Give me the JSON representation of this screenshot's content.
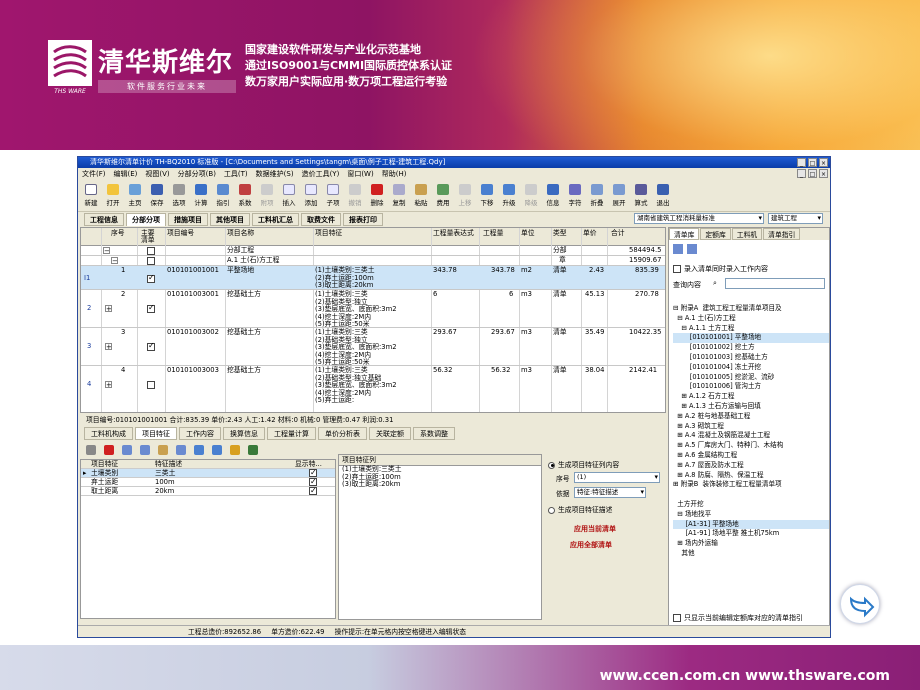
{
  "banner": {
    "brand": "清华斯维尔",
    "logo_sub": "THS WARE",
    "slogan": "软件服务行业未来",
    "taglines": [
      "国家建设软件研发与产业化示范基地",
      "通过ISO9001与CMMI国际质控体系认证",
      "数万家用户实际应用·数万项工程运行考验"
    ],
    "urls": "www.ccen.com.cn   www.thsware.com"
  },
  "window": {
    "title": "清华斯维尔清单计价 TH-BQ2010 标准版 - [C:\\Documents and Settings\\tangm\\桌面\\例子工程-建筑工程.Qdy]",
    "menus": [
      "文件(F)",
      "编辑(E)",
      "视图(V)",
      "分部分项(B)",
      "工具(T)",
      "数据维护(S)",
      "造价工具(Y)",
      "窗口(W)",
      "帮助(H)"
    ],
    "toolbar": [
      "新建",
      "打开",
      "主页",
      "保存",
      "选项",
      "计算",
      "指引",
      "系数",
      "附项",
      "插入",
      "添加",
      "子项",
      "撤销",
      "删除",
      "复制",
      "粘贴",
      "费用",
      "上移",
      "下移",
      "升级",
      "降级",
      "信息",
      "字符",
      "折叠",
      "展开",
      "算式",
      "退出"
    ],
    "tabs": [
      "工程信息",
      "分部分项",
      "措施项目",
      "其他项目",
      "工料机汇总",
      "取费文件",
      "报表打印"
    ],
    "region_select": "湖南省建筑工程消耗量标准",
    "type_select": "建筑工程"
  },
  "grid": {
    "headers": [
      "序号",
      "主要清单",
      "项目编号",
      "项目名称",
      "项目特征",
      "工程量表达式",
      "工程量",
      "单位",
      "类型",
      "单价",
      "合计"
    ],
    "rows": [
      {
        "name": "分部工程",
        "type": "分部",
        "total": "584494.5"
      },
      {
        "name": "A.1 土(石)方工程",
        "type": "章",
        "total": "15909.67"
      },
      {
        "idx": "I1",
        "seq": "1",
        "code": "010101001001",
        "name": "平整场地",
        "feat": "(1)土壤类别:三类土\n(2)弃土运距:100m\n(3)取土距离:20km",
        "expr": "343.78",
        "qty": "343.78",
        "unit": "m2",
        "type": "清单",
        "price": "2.43",
        "total": "835.39"
      },
      {
        "idx": "2",
        "seq": "2",
        "code": "010101003001",
        "name": "挖基础土方",
        "feat": "(1)土壤类别:三类\n(2)基础类型:独立\n(3)垫层底宽、底面积:3m2\n(4)挖土深度:2M内\n(5)弃土运距:50米",
        "expr": "6",
        "qty": "6",
        "unit": "m3",
        "type": "清单",
        "price": "45.13",
        "total": "270.78"
      },
      {
        "idx": "3",
        "seq": "3",
        "code": "010101003002",
        "name": "挖基础土方",
        "feat": "(1)土壤类别:三类\n(2)基础类型:独立\n(3)垫层底宽、底面积:3m2\n(4)挖土深度:2M内\n(5)弃土运距:50米",
        "expr": "293.67",
        "qty": "293.67",
        "unit": "m3",
        "type": "清单",
        "price": "35.49",
        "total": "10422.35"
      },
      {
        "idx": "4",
        "seq": "4",
        "code": "010101003003",
        "name": "挖基础土方",
        "feat": "(1)土壤类别:三类\n(2)基础类型:独立基础\n(3)垫层底宽、底面积:3m2\n(4)挖土深度:2M内\n(5)弃土运距:",
        "expr": "56.32",
        "qty": "56.32",
        "unit": "m3",
        "type": "清单",
        "price": "38.04",
        "total": "2142.41"
      }
    ]
  },
  "infoline": "项目编号:010101001001  合计:835.39  单价:2.43  人工:1.42  材料:0  机械:0  管理费:0.47  利润:0.31",
  "subtabs": [
    "工料机构成",
    "项目特征",
    "工作内容",
    "换算信息",
    "工程量计算",
    "单价分析表",
    "关联定额",
    "系数调整"
  ],
  "features": {
    "headers": [
      "项目特征",
      "特征描述",
      "显示特..."
    ],
    "rows": [
      [
        "土壤类别",
        "三类土"
      ],
      [
        "弃土运距",
        "100m"
      ],
      [
        "取土距离",
        "20km"
      ]
    ]
  },
  "feature_text": {
    "header": "项目特征列",
    "lines": [
      "(1)土壤类别:三类土",
      "(2)弃土运距:100m",
      "(3)取土距离:20km"
    ]
  },
  "options": {
    "radio1": "生成项目特征列内容",
    "seq_label": "序号",
    "seq_value": "(1)",
    "basis_label": "依据",
    "basis_value": "特征:特征描述",
    "radio2": "生成项目特征描述",
    "apply_current": "应用当前清单",
    "apply_all": "应用全部清单"
  },
  "rpanel": {
    "tabs": [
      "清单库",
      "定额库",
      "工料机",
      "清单指引"
    ],
    "checkbox1": "录入清单同时录入工作内容",
    "query_label": "查询内容",
    "tree": [
      "⊟ 附录A  建筑工程工程量清单项目及",
      "  ⊟ A.1 土(石)方工程",
      "    ⊟ A.1.1 土方工程",
      "        [010101001] 平整场地",
      "        [010101002] 挖土方",
      "        [010101003] 挖基础土方",
      "        [010101004] 冻土开挖",
      "        [010101005] 挖淤泥、流砂",
      "        [010101006] 管沟土方",
      "    ⊞ A.1.2 石方工程",
      "    ⊞ A.1.3 土石方运输与回填",
      "  ⊞ A.2 桩与地基基础工程",
      "  ⊞ A.3 砌筑工程",
      "  ⊞ A.4 混凝土及钢筋混凝土工程",
      "  ⊞ A.5 厂库房大门、特种门、木结构",
      "  ⊞ A.6 金属结构工程",
      "  ⊞ A.7 屋面及防水工程",
      "  ⊞ A.8 防腐、隔热、保温工程",
      "⊞ 附录B  装饰装修工程工程量清单项",
      "",
      "  土方开挖",
      "  ⊟ 场地找平",
      "      [A1-31] 平整场地",
      "      [A1-91] 场地平整 推土机75km",
      "  ⊞ 场内外运输",
      "    其他"
    ],
    "checkbox2": "只显示当前编辑定额库对应的清单指引"
  },
  "status": {
    "total": "工程总造价:892652.86",
    "unit_cost": "单方造价:622.49",
    "hint": "操作提示:在单元格内按空格键进入编辑状态"
  },
  "colors": {
    "banner": "#a0166e",
    "titlebar": "#0a3ca8",
    "selected_row": "#cde4f7",
    "accent_red": "#b01010"
  }
}
